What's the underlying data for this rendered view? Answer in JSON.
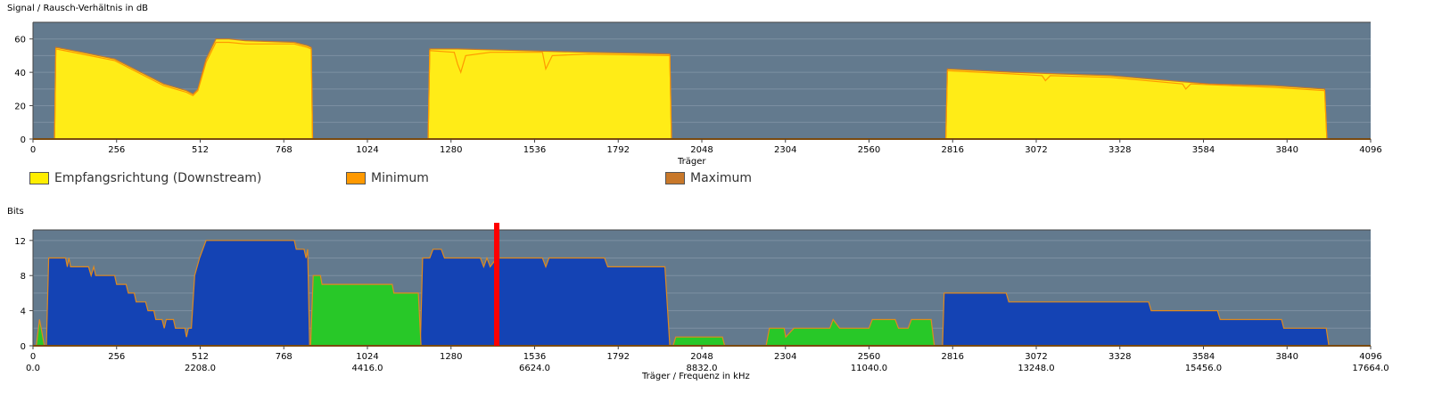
{
  "chart_data": [
    {
      "type": "area",
      "title": "Signal / Rausch-Verhältnis in dB",
      "xlabel": "Träger",
      "xlim": [
        0,
        4096
      ],
      "ylim": [
        0,
        70
      ],
      "xticks": [
        0,
        256,
        512,
        768,
        1024,
        1280,
        1536,
        1792,
        2048,
        2304,
        2560,
        2816,
        3072,
        3328,
        3584,
        3840,
        4096
      ],
      "yticks": [
        0,
        20,
        40,
        60
      ],
      "legend": [
        "Empfangsrichtung (Downstream)",
        "Minimum",
        "Maximum"
      ],
      "colors": {
        "downstream": "#ffec17",
        "minimum": "#ff9900",
        "maximum": "#c8782a",
        "plot_bg": "#637a8e"
      },
      "series": [
        {
          "name": "Empfangsrichtung (Downstream)",
          "points": [
            [
              0,
              0
            ],
            [
              66,
              0
            ],
            [
              70,
              55
            ],
            [
              150,
              52
            ],
            [
              250,
              48
            ],
            [
              330,
              40
            ],
            [
              400,
              33
            ],
            [
              470,
              29
            ],
            [
              490,
              27
            ],
            [
              505,
              30
            ],
            [
              530,
              48
            ],
            [
              560,
              60
            ],
            [
              600,
              60
            ],
            [
              650,
              59
            ],
            [
              800,
              58
            ],
            [
              840,
              56
            ],
            [
              852,
              55
            ],
            [
              856,
              0
            ],
            [
              1210,
              0
            ],
            [
              1215,
              54
            ],
            [
              1300,
              54
            ],
            [
              1500,
              53
            ],
            [
              1700,
              52
            ],
            [
              1950,
              51
            ],
            [
              1955,
              0
            ],
            [
              2795,
              0
            ],
            [
              2800,
              42
            ],
            [
              3000,
              40
            ],
            [
              3300,
              38
            ],
            [
              3600,
              33
            ],
            [
              3800,
              32
            ],
            [
              3955,
              30
            ],
            [
              3962,
              0
            ],
            [
              4096,
              0
            ]
          ]
        },
        {
          "name": "Minimum",
          "points": [
            [
              0,
              0
            ],
            [
              66,
              0
            ],
            [
              70,
              54
            ],
            [
              150,
              51
            ],
            [
              250,
              47
            ],
            [
              330,
              39
            ],
            [
              400,
              32
            ],
            [
              470,
              28
            ],
            [
              490,
              26
            ],
            [
              505,
              29
            ],
            [
              530,
              46
            ],
            [
              560,
              58
            ],
            [
              600,
              58
            ],
            [
              650,
              57
            ],
            [
              800,
              57
            ],
            [
              840,
              55
            ],
            [
              852,
              54
            ],
            [
              856,
              0
            ],
            [
              1210,
              0
            ],
            [
              1215,
              53
            ],
            [
              1290,
              52
            ],
            [
              1300,
              45
            ],
            [
              1310,
              40
            ],
            [
              1325,
              50
            ],
            [
              1400,
              52
            ],
            [
              1560,
              52
            ],
            [
              1570,
              42
            ],
            [
              1590,
              50
            ],
            [
              1700,
              51
            ],
            [
              1950,
              50
            ],
            [
              1955,
              0
            ],
            [
              2795,
              0
            ],
            [
              2800,
              41
            ],
            [
              3000,
              39
            ],
            [
              3090,
              38
            ],
            [
              3100,
              35
            ],
            [
              3115,
              38
            ],
            [
              3300,
              37
            ],
            [
              3520,
              33
            ],
            [
              3530,
              30
            ],
            [
              3545,
              33
            ],
            [
              3800,
              31
            ],
            [
              3955,
              29
            ],
            [
              3962,
              0
            ],
            [
              4096,
              0
            ]
          ]
        }
      ]
    },
    {
      "type": "area",
      "title": "Bits",
      "xlabel": "Träger / Frequenz in kHz",
      "xlim": [
        0,
        4096
      ],
      "ylim": [
        0,
        13.2
      ],
      "xticks": [
        0,
        256,
        512,
        768,
        1024,
        1280,
        1536,
        1792,
        2048,
        2304,
        2560,
        2816,
        3072,
        3328,
        3584,
        3840,
        4096
      ],
      "freq_ticks": {
        "0": "0.0",
        "512": "2208.0",
        "1024": "4416.0",
        "1536": "6624.0",
        "2048": "8832.0",
        "2560": "11040.0",
        "3072": "13248.0",
        "3584": "15456.0",
        "4096": "17664.0"
      },
      "yticks": [
        0,
        4,
        8,
        12
      ],
      "marker_carrier": 1420,
      "colors": {
        "downstream": "#1443b4",
        "upstream": "#28c828",
        "outline": "#e08a1e",
        "marker": "#ff0000",
        "plot_bg": "#637a8e"
      },
      "series": [
        {
          "name": "Downstream",
          "points": [
            [
              0,
              0
            ],
            [
              41,
              0
            ],
            [
              48,
              10
            ],
            [
              100,
              10
            ],
            [
              105,
              9
            ],
            [
              110,
              10
            ],
            [
              115,
              9
            ],
            [
              170,
              9
            ],
            [
              178,
              8
            ],
            [
              186,
              9
            ],
            [
              192,
              8
            ],
            [
              250,
              8
            ],
            [
              256,
              7
            ],
            [
              285,
              7
            ],
            [
              292,
              6
            ],
            [
              310,
              6
            ],
            [
              316,
              5
            ],
            [
              345,
              5
            ],
            [
              352,
              4
            ],
            [
              370,
              4
            ],
            [
              376,
              3
            ],
            [
              395,
              3
            ],
            [
              402,
              2
            ],
            [
              408,
              3
            ],
            [
              430,
              3
            ],
            [
              436,
              2
            ],
            [
              465,
              2
            ],
            [
              470,
              1
            ],
            [
              476,
              2
            ],
            [
              485,
              2
            ],
            [
              495,
              8
            ],
            [
              510,
              10
            ],
            [
              530,
              12
            ],
            [
              800,
              12
            ],
            [
              806,
              11
            ],
            [
              830,
              11
            ],
            [
              836,
              10
            ],
            [
              841,
              11
            ],
            [
              847,
              0
            ],
            [
              1186,
              0
            ],
            [
              1193,
              10
            ],
            [
              1215,
              10
            ],
            [
              1225,
              11
            ],
            [
              1250,
              11
            ],
            [
              1260,
              10
            ],
            [
              1370,
              10
            ],
            [
              1380,
              9
            ],
            [
              1390,
              10
            ],
            [
              1400,
              9
            ],
            [
              1420,
              10
            ],
            [
              1560,
              10
            ],
            [
              1570,
              9
            ],
            [
              1580,
              10
            ],
            [
              1750,
              10
            ],
            [
              1760,
              9
            ],
            [
              1935,
              9
            ],
            [
              1950,
              0
            ],
            [
              2785,
              0
            ],
            [
              2790,
              6
            ],
            [
              2980,
              6
            ],
            [
              2988,
              5
            ],
            [
              3416,
              5
            ],
            [
              3424,
              4
            ],
            [
              3627,
              4
            ],
            [
              3635,
              3
            ],
            [
              3823,
              3
            ],
            [
              3830,
              2
            ],
            [
              3960,
              2
            ],
            [
              3968,
              0
            ],
            [
              4096,
              0
            ]
          ]
        },
        {
          "name": "Upstream",
          "points": [
            [
              0,
              0
            ],
            [
              10,
              0
            ],
            [
              20,
              3
            ],
            [
              35,
              0
            ],
            [
              850,
              0
            ],
            [
              858,
              8
            ],
            [
              880,
              8
            ],
            [
              885,
              7
            ],
            [
              1100,
              7
            ],
            [
              1105,
              6
            ],
            [
              1180,
              6
            ],
            [
              1188,
              0
            ],
            [
              1960,
              0
            ],
            [
              1968,
              1
            ],
            [
              2111,
              1
            ],
            [
              2118,
              0
            ],
            [
              2245,
              0
            ],
            [
              2255,
              2
            ],
            [
              2300,
              2
            ],
            [
              2305,
              1
            ],
            [
              2330,
              2
            ],
            [
              2440,
              2
            ],
            [
              2450,
              3
            ],
            [
              2470,
              2
            ],
            [
              2560,
              2
            ],
            [
              2570,
              3
            ],
            [
              2640,
              3
            ],
            [
              2650,
              2
            ],
            [
              2680,
              2
            ],
            [
              2690,
              3
            ],
            [
              2750,
              3
            ],
            [
              2760,
              0
            ],
            [
              4096,
              0
            ]
          ]
        }
      ]
    }
  ]
}
